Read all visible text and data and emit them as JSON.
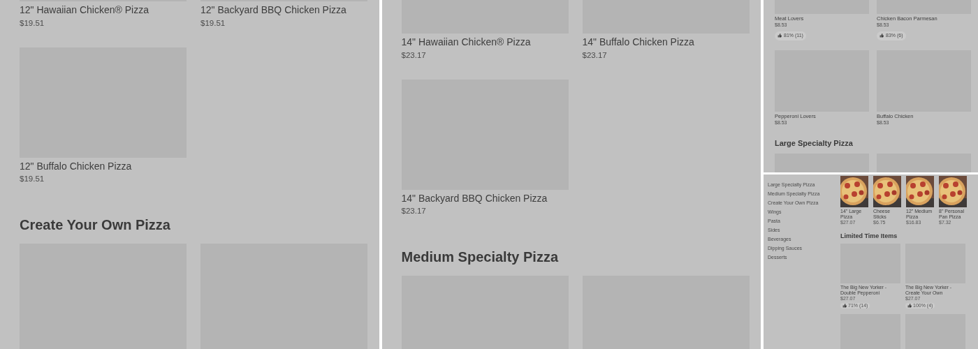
{
  "panels": [
    {
      "kind": "large",
      "sections": [
        {
          "items": [
            {
              "kind": "placeholder",
              "name": "12\" Hawaiian Chicken® Pizza",
              "price": "$19.51"
            },
            {
              "kind": "placeholder",
              "name": "12\" Backyard BBQ Chicken Pizza",
              "price": "$19.51"
            },
            {
              "kind": "placeholder",
              "name": "12\" Buffalo Chicken Pizza",
              "price": "$19.51"
            }
          ]
        },
        {
          "heading": "Create Your Own Pizza",
          "items": [
            {
              "kind": "placeholder"
            },
            {
              "kind": "placeholder"
            }
          ]
        }
      ]
    },
    {
      "kind": "large",
      "sections": [
        {
          "items": [
            {
              "kind": "placeholder",
              "name": "14\" Hawaiian Chicken® Pizza",
              "price": "$23.17"
            },
            {
              "kind": "placeholder",
              "name": "14\" Buffalo Chicken Pizza",
              "price": "$23.17"
            },
            {
              "kind": "placeholder",
              "name": "14\" Backyard BBQ Chicken Pizza",
              "price": "$23.17"
            }
          ]
        },
        {
          "heading": "Medium Specialty Pizza",
          "items": [
            {
              "kind": "placeholder"
            },
            {
              "kind": "placeholder"
            }
          ]
        }
      ]
    },
    {
      "kind": "small",
      "sections": [
        {
          "items": [
            {
              "kind": "placeholder",
              "name": "Meat Lovers",
              "price": "$8.53",
              "rating": "81% (11)"
            },
            {
              "kind": "placeholder",
              "name": "Chicken Bacon Parmesan",
              "price": "$8.53",
              "rating": "83% (6)"
            },
            {
              "kind": "placeholder",
              "name": "Pepperoni Lovers",
              "price": "$8.53"
            },
            {
              "kind": "placeholder",
              "name": "Buffalo Chicken",
              "price": "$8.53"
            }
          ]
        },
        {
          "heading": "Large Specialty Pizza",
          "items": [
            {
              "kind": "placeholder"
            },
            {
              "kind": "placeholder"
            }
          ]
        }
      ]
    },
    {
      "kind": "menu",
      "sidebar": {
        "items": [
          "Large Specialty Pizza",
          "Medium Specialty Pizza",
          "Create Your Own Pizza",
          "Wings",
          "Pasta",
          "Sides",
          "Beverages",
          "Dipping Sauces",
          "Desserts"
        ]
      },
      "sections": [
        {
          "kind": "thumbs",
          "items": [
            {
              "name": "14\" Large Pizza",
              "price": "$27.07",
              "kind": "picture"
            },
            {
              "name": "Cheese Sticks",
              "price": "$6.75",
              "kind": "picture"
            },
            {
              "name": "12\" Medium Pizza",
              "price": "$16.83",
              "kind": "picture"
            },
            {
              "name": "8\" Personal Pan Pizza",
              "price": "$7.32",
              "kind": "picture"
            }
          ]
        },
        {
          "kind": "cards",
          "heading": "Limited Time Items",
          "items": [
            {
              "kind": "placeholder",
              "name": "The Big New Yorker - Double Pepperoni",
              "price": "$27.07",
              "rating": "71% (14)"
            },
            {
              "kind": "placeholder",
              "name": "The Big New Yorker - Create Your Own",
              "price": "$27.07",
              "rating": "100% (4)"
            },
            {
              "kind": "placeholder"
            },
            {
              "kind": "placeholder"
            }
          ]
        }
      ]
    }
  ]
}
